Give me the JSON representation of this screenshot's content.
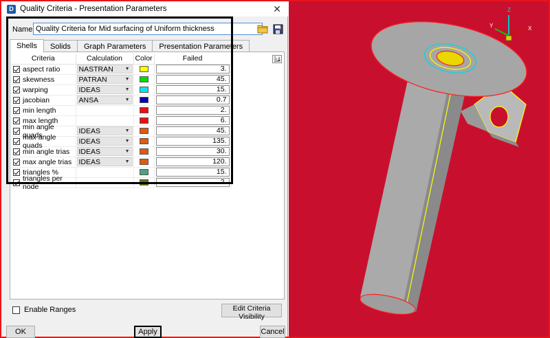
{
  "window": {
    "title": "Quality Criteria - Presentation Parameters",
    "app_icon_letter": "D",
    "close_glyph": "✕"
  },
  "name": {
    "label": "Name:",
    "value": "Quality Criteria for Mid surfacing of Uniform thickness"
  },
  "tabs": [
    {
      "label": "Shells",
      "active": true
    },
    {
      "label": "Solids",
      "active": false
    },
    {
      "label": "Graph Parameters",
      "active": false
    },
    {
      "label": "Presentation Parameters",
      "active": false
    }
  ],
  "grid": {
    "headers": {
      "criteria": "Criteria",
      "calculation": "Calculation",
      "color": "Color",
      "failed": "Failed"
    },
    "rows": [
      {
        "criteria": "aspect ratio",
        "calculation": "NASTRAN",
        "color": "#ffff00",
        "failed": "3."
      },
      {
        "criteria": "skewness",
        "calculation": "PATRAN",
        "color": "#00e000",
        "failed": "45."
      },
      {
        "criteria": "warping",
        "calculation": "IDEAS",
        "color": "#00e8f0",
        "failed": "15."
      },
      {
        "criteria": "jacobian",
        "calculation": "ANSA",
        "color": "#0000b0",
        "failed": "0.7"
      },
      {
        "criteria": "min length",
        "calculation": "",
        "color": "#e81010",
        "failed": "2."
      },
      {
        "criteria": "max length",
        "calculation": "",
        "color": "#e81010",
        "failed": "6."
      },
      {
        "criteria": "min angle quads",
        "calculation": "IDEAS",
        "color": "#e05a10",
        "failed": "45."
      },
      {
        "criteria": "max angle quads",
        "calculation": "IDEAS",
        "color": "#e05a10",
        "failed": "135."
      },
      {
        "criteria": "min angle trias",
        "calculation": "IDEAS",
        "color": "#e05a10",
        "failed": "30."
      },
      {
        "criteria": "max angle trias",
        "calculation": "IDEAS",
        "color": "#e05a10",
        "failed": "120."
      },
      {
        "criteria": "triangles %",
        "calculation": "",
        "color": "#50a080",
        "failed": "15."
      },
      {
        "criteria": "triangles per node",
        "calculation": "",
        "color": "#6b6b10",
        "failed": "2."
      }
    ]
  },
  "options": {
    "enable_ranges_label": "Enable Ranges",
    "edit_visibility_label": "Edit Criteria Visibility"
  },
  "buttons": {
    "ok": "OK",
    "apply": "Apply",
    "cancel": "Cancel"
  },
  "viewport": {
    "background": "#c8102e",
    "axes": {
      "x": "X",
      "y": "Y",
      "z": "Z"
    },
    "part_color": "#a8a8a8",
    "edge_color": "#ffff00"
  }
}
